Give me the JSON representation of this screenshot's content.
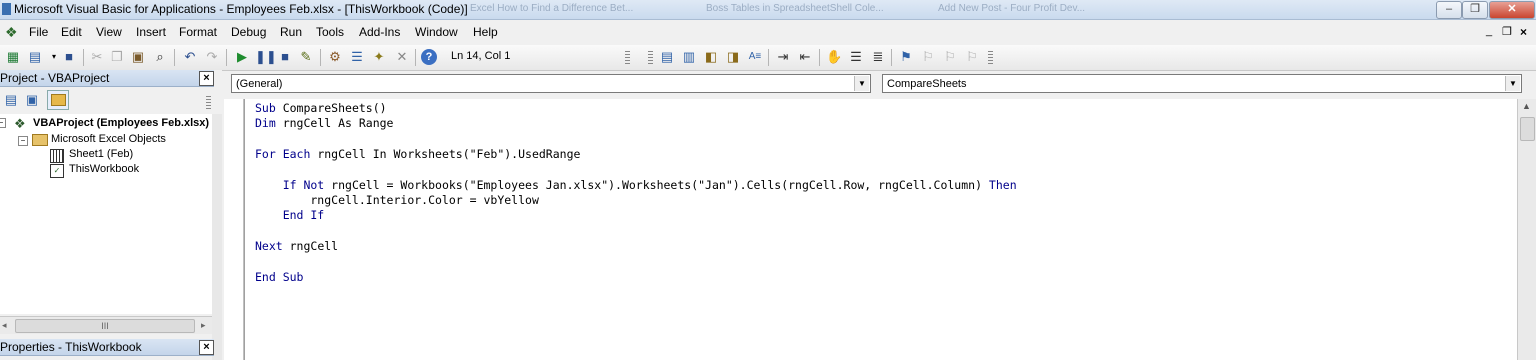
{
  "window": {
    "title": "Microsoft Visual Basic for Applications - Employees Feb.xlsx - [ThisWorkbook (Code)]",
    "background_tabs": [
      "Excel How to Find a Difference Bet...",
      "Boss Tables in SpreadsheetShell Cole...",
      "Add New Post - Four Profit Dev..."
    ],
    "min_label": "–",
    "max_label": "❐",
    "close_label": "✕"
  },
  "menu": {
    "items": [
      "File",
      "Edit",
      "View",
      "Insert",
      "Format",
      "Debug",
      "Run",
      "Tools",
      "Add-Ins",
      "Window",
      "Help"
    ],
    "mdi_controls": [
      "_",
      "❐",
      "×"
    ]
  },
  "toolbar": {
    "position": "Ln 14, Col 1"
  },
  "project_panel": {
    "title": "Project - VBAProject",
    "close": "×",
    "tree": {
      "root": "VBAProject (Employees Feb.xlsx)",
      "folder": "Microsoft Excel Objects",
      "items": [
        "Sheet1 (Feb)",
        "ThisWorkbook"
      ]
    },
    "hscroll_thumb": "III"
  },
  "properties_panel": {
    "title": "Properties - ThisWorkbook",
    "close": "×"
  },
  "code_window": {
    "object_combo": "(General)",
    "procedure_combo": "CompareSheets",
    "lines": [
      {
        "kw": "Sub",
        "rest": " CompareSheets()"
      },
      {
        "kw": "Dim",
        "rest": " rngCell As Range"
      },
      {
        "kw": "",
        "rest": ""
      },
      {
        "kw": "For Each",
        "rest": " rngCell In Worksheets(\"Feb\").UsedRange"
      },
      {
        "kw": "",
        "rest": ""
      },
      {
        "kw": "    If Not",
        "rest": " rngCell = Workbooks(\"Employees Jan.xlsx\").Worksheets(\"Jan\").Cells(rngCell.Row, rngCell.Column) Then"
      },
      {
        "kw": "",
        "rest": "        rngCell.Interior.Color = vbYellow"
      },
      {
        "kw": "    End If",
        "rest": ""
      },
      {
        "kw": "",
        "rest": ""
      },
      {
        "kw": "Next",
        "rest": " rngCell"
      },
      {
        "kw": "",
        "rest": ""
      },
      {
        "kw": "End Sub",
        "rest": ""
      }
    ]
  }
}
